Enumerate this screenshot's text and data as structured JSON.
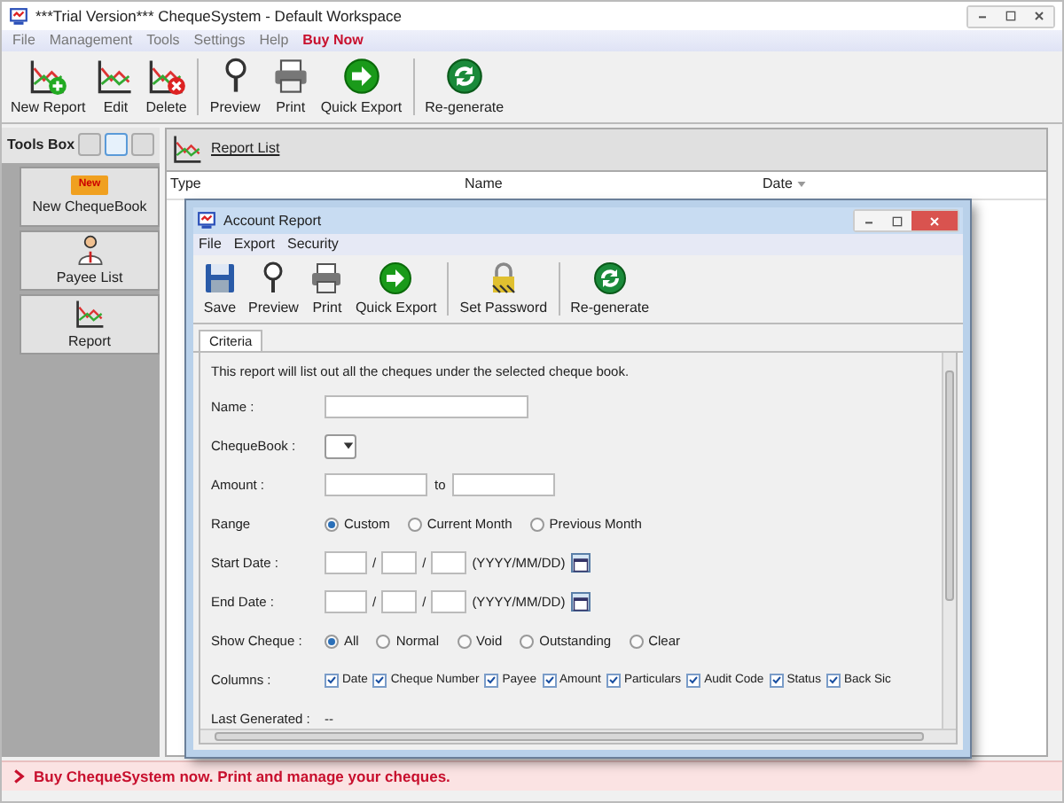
{
  "window": {
    "title": "***Trial Version*** ChequeSystem - Default Workspace"
  },
  "menu": [
    {
      "label": "File",
      "kind": "normal"
    },
    {
      "label": "Management",
      "kind": "normal"
    },
    {
      "label": "Tools",
      "kind": "normal"
    },
    {
      "label": "Settings",
      "kind": "normal"
    },
    {
      "label": "Help",
      "kind": "normal"
    },
    {
      "label": "Buy Now",
      "kind": "promo"
    }
  ],
  "toolbar": [
    [
      {
        "label": "New Report",
        "kind": "new"
      },
      {
        "label": "Edit",
        "kind": "chart"
      },
      {
        "label": "Delete",
        "kind": "delete"
      }
    ],
    [
      {
        "label": "Preview",
        "kind": "preview"
      },
      {
        "label": "Print",
        "kind": "print"
      },
      {
        "label": "Quick Export",
        "kind": "export"
      }
    ],
    [
      {
        "label": "Re-generate",
        "kind": "regenerate"
      }
    ]
  ],
  "sidebar": {
    "title": "Tools Box",
    "view_buttons": [
      {
        "selected": false
      },
      {
        "selected": true
      },
      {
        "selected": false
      }
    ],
    "items": [
      {
        "label": "New ChequeBook",
        "kind": "folder",
        "badge": "New"
      },
      {
        "label": "Payee List",
        "kind": "person"
      },
      {
        "label": "Report",
        "kind": "chart"
      }
    ]
  },
  "report_list": {
    "title": "Report List",
    "columns": [
      {
        "label": "Type",
        "sorted": false
      },
      {
        "label": "Name",
        "sorted": false
      },
      {
        "label": "Date",
        "sorted": true
      }
    ]
  },
  "dialog": {
    "title": "Account Report",
    "menu": [
      "File",
      "Export",
      "Security"
    ],
    "toolbar": [
      [
        {
          "label": "Save",
          "kind": "save"
        },
        {
          "label": "Preview",
          "kind": "preview"
        },
        {
          "label": "Print",
          "kind": "print"
        },
        {
          "label": "Quick Export",
          "kind": "export"
        }
      ],
      [
        {
          "label": "Set Password",
          "kind": "password"
        }
      ],
      [
        {
          "label": "Re-generate",
          "kind": "regenerate"
        }
      ]
    ],
    "tabs": [
      {
        "label": "Criteria",
        "selected": true
      }
    ],
    "description": "This report will list out all the cheques under the selected cheque book.",
    "fields": [
      {
        "kind": "text",
        "label": "Name :"
      },
      {
        "kind": "combo",
        "label": "ChequeBook :"
      },
      {
        "kind": "range",
        "label": "Amount :",
        "separator": "to"
      },
      {
        "kind": "radio",
        "label": "Range",
        "options": [
          {
            "label": "Custom",
            "selected": true
          },
          {
            "label": "Current Month",
            "selected": false
          },
          {
            "label": "Previous Month",
            "selected": false
          }
        ]
      },
      {
        "kind": "date",
        "label": "Start Date :",
        "separators": [
          "/",
          "/"
        ],
        "hint": "(YYYY/MM/DD)"
      },
      {
        "kind": "date",
        "label": "End Date :",
        "separators": [
          "/",
          "/"
        ],
        "hint": "(YYYY/MM/DD)"
      },
      {
        "kind": "radio",
        "label": "Show Cheque :",
        "options": [
          {
            "label": "All",
            "selected": true
          },
          {
            "label": "Normal",
            "selected": false
          },
          {
            "label": "Void",
            "selected": false
          },
          {
            "label": "Outstanding",
            "selected": false
          },
          {
            "label": "Clear",
            "selected": false
          }
        ]
      },
      {
        "kind": "checks",
        "label": "Columns :",
        "options": [
          {
            "label": "Date",
            "checked": true
          },
          {
            "label": "Cheque Number",
            "checked": true
          },
          {
            "label": "Payee",
            "checked": true
          },
          {
            "label": "Amount",
            "checked": true
          },
          {
            "label": "Particulars",
            "checked": true
          },
          {
            "label": "Audit Code",
            "checked": true
          },
          {
            "label": "Status",
            "checked": true
          },
          {
            "label": "Back Sic",
            "checked": true
          }
        ]
      },
      {
        "kind": "value",
        "label": "Last Generated :",
        "value": "--"
      }
    ]
  },
  "status_bar": {
    "text": "Buy ChequeSystem now. Print and manage your cheques."
  }
}
